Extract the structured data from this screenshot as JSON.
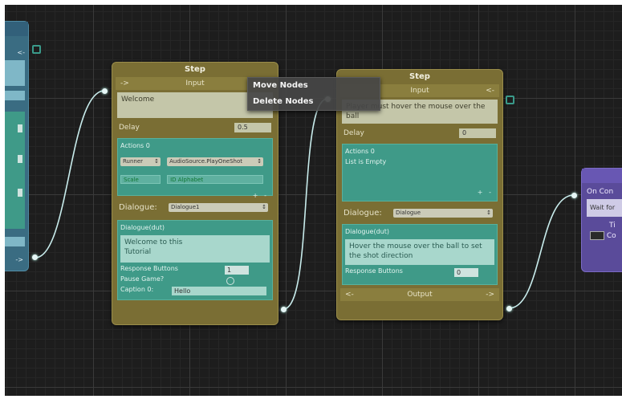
{
  "menu": {
    "items": [
      "Move Nodes",
      "Delete Nodes"
    ]
  },
  "node1": {
    "title": "Step",
    "input_label": "Input",
    "input_arrow": "->",
    "text": "Welcome",
    "delay_label": "Delay",
    "delay_value": "0.5",
    "actions_label": "Actions 0",
    "action_dropdown": "Runner",
    "action_method": "AudioSource.PlayOneShot",
    "action_obj1": "Scale",
    "action_obj2": "ID Alphabet",
    "dialogue_label": "Dialogue:",
    "dialogue_value": "Dialogue1",
    "dialogue_box_label": "Dialogue(dut)",
    "dialogue_text": "Welcome to this\nTutorial",
    "response_label": "Response Buttons",
    "response_value": "1",
    "pause_label": "Pause Game?",
    "caption_label": "Caption 0:",
    "caption_value": "Hello"
  },
  "node2": {
    "title": "Step",
    "input_label": "Input",
    "input_arrow": "<-",
    "text": "Player must hover the mouse over the ball",
    "delay_label": "Delay",
    "delay_value": "0",
    "actions_label": "Actions 0",
    "actions_empty": "List is Empty",
    "dialogue_label": "Dialogue:",
    "dialogue_value": "Dialogue",
    "dialogue_box_label": "Dialogue(dut)",
    "dialogue_text": "Hover the mouse over the ball to set the shot direction",
    "response_label": "Response Buttons",
    "response_value": "0",
    "output_label": "Output",
    "output_arrow_left": "<-",
    "output_arrow_right": "->"
  },
  "node_right": {
    "label": "On Con",
    "field": "Wait for",
    "t_label": "Ti",
    "c_label": "Co"
  },
  "node_left": {
    "arrow": "<-",
    "arrow_out": "->"
  },
  "icons": {
    "plus": "+",
    "minus": "-",
    "chevron": "↕"
  },
  "colors": {
    "step_node": "#7a6e34",
    "wire": "#c8ecec",
    "right_node": "#5a4b9a"
  }
}
